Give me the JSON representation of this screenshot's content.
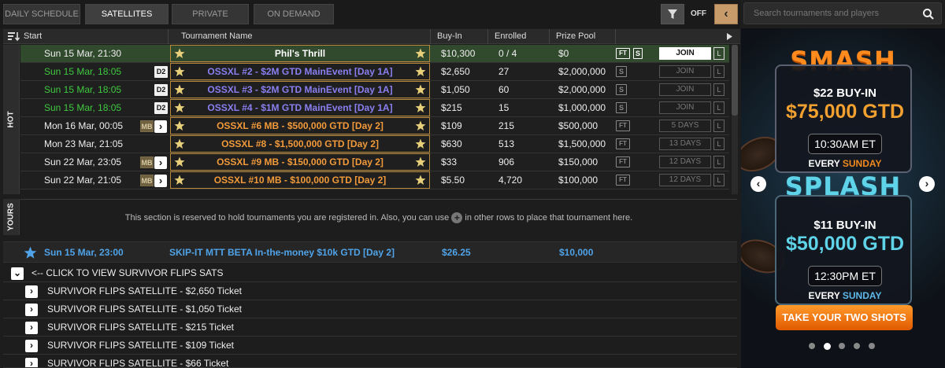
{
  "tabs": [
    {
      "label": "DAILY SCHEDULE"
    },
    {
      "label": "SATELLITES"
    },
    {
      "label": "PRIVATE"
    },
    {
      "label": "ON DEMAND"
    }
  ],
  "filter": {
    "toggle_label": "OFF"
  },
  "search": {
    "placeholder": "Search tournaments and players"
  },
  "columns": {
    "start": "Start",
    "name": "Tournament Name",
    "buyin": "Buy-In",
    "enrolled": "Enrolled",
    "prize": "Prize Pool"
  },
  "sections": {
    "hot": "HOT",
    "yours": "YOURS"
  },
  "rows": [
    {
      "start": "Sun  15 Mar, 21:30",
      "badge": "",
      "name": "Phil's Thrill",
      "buyin": "$10,300",
      "enrolled": "0 / 4",
      "prize": "$0",
      "action": "JOIN",
      "l": "L"
    },
    {
      "start": "Sun  15 Mar, 18:05",
      "badge": "D2",
      "name": "OSSXL #2 - $2M GTD MainEvent [Day 1A]",
      "buyin": "$2,650",
      "enrolled": "27",
      "prize": "$2,000,000",
      "action": "JOIN",
      "l": "L"
    },
    {
      "start": "Sun  15 Mar, 18:05",
      "badge": "D2",
      "name": "OSSXL #3 - $2M GTD MainEvent [Day 1A]",
      "buyin": "$1,050",
      "enrolled": "60",
      "prize": "$2,000,000",
      "action": "JOIN",
      "l": "L"
    },
    {
      "start": "Sun  15 Mar, 18:05",
      "badge": "D2",
      "name": "OSSXL #4 - $1M GTD MainEvent [Day 1A]",
      "buyin": "$215",
      "enrolled": "15",
      "prize": "$1,000,000",
      "action": "JOIN",
      "l": "L"
    },
    {
      "start": "Mon 16 Mar, 00:05",
      "badge": "MB",
      "name": "OSSXL #6 MB - $500,000 GTD [Day 2]",
      "buyin": "$109",
      "enrolled": "215",
      "prize": "$500,000",
      "action": "5 DAYS",
      "l": "L"
    },
    {
      "start": "Mon 23 Mar, 21:05",
      "badge": "",
      "name": "OSSXL #8 - $1,500,000 GTD [Day 2]",
      "buyin": "$630",
      "enrolled": "513",
      "prize": "$1,500,000",
      "action": "13 DAYS",
      "l": "L"
    },
    {
      "start": "Sun  22 Mar, 23:05",
      "badge": "MB",
      "name": "OSSXL #9 MB - $150,000 GTD [Day 2]",
      "buyin": "$33",
      "enrolled": "906",
      "prize": "$150,000",
      "action": "12 DAYS",
      "l": "L"
    },
    {
      "start": "Sun  22 Mar, 21:05",
      "badge": "MB",
      "name": "OSSXL #10 MB - $100,000 GTD [Day 2]",
      "buyin": "$5.50",
      "enrolled": "4,720",
      "prize": "$100,000",
      "action": "12 DAYS",
      "l": "L"
    }
  ],
  "icons": {
    "ft": "FT",
    "s": "S"
  },
  "yours_msg_a": "This section is reserved to hold tournaments you are registered in. Also, you can use",
  "yours_msg_b": "in other rows to place that tournament here.",
  "promo": {
    "start": "Sun  15 Mar, 23:00",
    "name": "SKIP-IT MTT BETA In-the-money $10k GTD [Day 2]",
    "buyin": "$26.25",
    "prize": "$10,000"
  },
  "survivor": {
    "header": "<-- CLICK TO VIEW SURVIVOR FLIPS SATS",
    "items": [
      "SURVIVOR FLIPS SATELLITE - $2,650 Ticket",
      "SURVIVOR FLIPS SATELLITE - $1,050 Ticket",
      "SURVIVOR FLIPS SATELLITE - $215 Ticket",
      "SURVIVOR FLIPS SATELLITE - $109 Ticket",
      "SURVIVOR FLIPS SATELLITE - $66 Ticket"
    ]
  },
  "banner": {
    "smash": {
      "logo": "SMASH",
      "buyin": "$22 BUY-IN",
      "gtd": "$75,000 GTD",
      "time": "10:30AM ET",
      "every": "EVERY",
      "day": "SUNDAY"
    },
    "splash": {
      "logo": "SPLASH",
      "buyin": "$11 BUY-IN",
      "gtd": "$50,000 GTD",
      "time": "12:30PM ET",
      "every": "EVERY",
      "day": "SUNDAY"
    },
    "cta": "TAKE YOUR TWO SHOTS",
    "active_slide": 2,
    "slide_count": 5
  },
  "colors": {
    "accent": "#c89c6a",
    "green_time": "#3fc93f",
    "promo_blue": "#4fa3e8",
    "blue_name": "#8a7ff0",
    "orange_name": "#f29a3a",
    "smash_orange": "#ff8a1e",
    "splash_cyan": "#5fd3e8"
  }
}
